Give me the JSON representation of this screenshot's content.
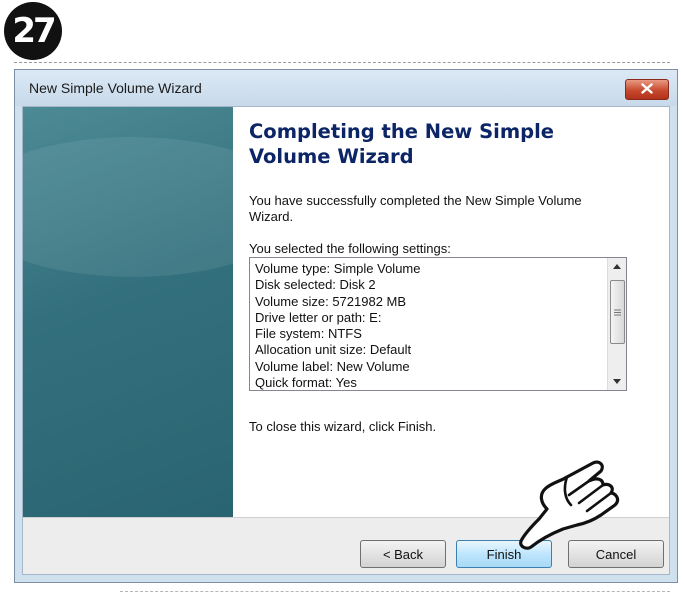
{
  "step": "27",
  "window": {
    "title": "New Simple Volume Wizard"
  },
  "page": {
    "heading": "Completing the New Simple Volume Wizard",
    "success_text": "You have successfully completed the New Simple Volume Wizard.",
    "settings_label": "You selected the following settings:",
    "settings": [
      "Volume type: Simple Volume",
      "Disk selected: Disk 2",
      "Volume size: 5721982 MB",
      "Drive letter or path: E:",
      "File system: NTFS",
      "Allocation unit size: Default",
      "Volume label: New Volume",
      "Quick format: Yes"
    ],
    "close_text": "To close this wizard, click Finish."
  },
  "buttons": {
    "back": "< Back",
    "finish": "Finish",
    "cancel": "Cancel"
  },
  "colors": {
    "side_panel": "#33707d",
    "heading": "#0b2566",
    "close_button": "#c74a2e",
    "finish_highlight": "#bee6fd"
  },
  "icons": [
    "close-icon",
    "scroll-up-icon",
    "scroll-down-icon",
    "pointing-hand-icon"
  ]
}
